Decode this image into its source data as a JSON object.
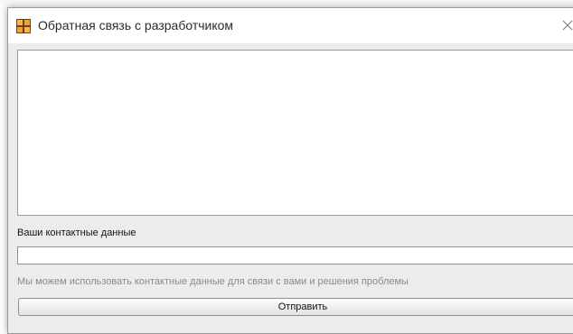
{
  "window": {
    "title": "Обратная связь с разработчиком",
    "icon": "app-window-icon",
    "close_icon": "close-icon"
  },
  "form": {
    "message_value": "",
    "contact_label": "Ваши контактные данные",
    "contact_value": "",
    "hint": "Мы можем использовать контактные данные для связи с вами и решения проблемы",
    "submit_label": "Отправить"
  },
  "colors": {
    "dialog_background": "#ececec",
    "titlebar_background": "#ffffff",
    "hint_text": "#8a8a8a",
    "icon_orange": "#e8a43a",
    "icon_dark": "#7a3b12"
  }
}
